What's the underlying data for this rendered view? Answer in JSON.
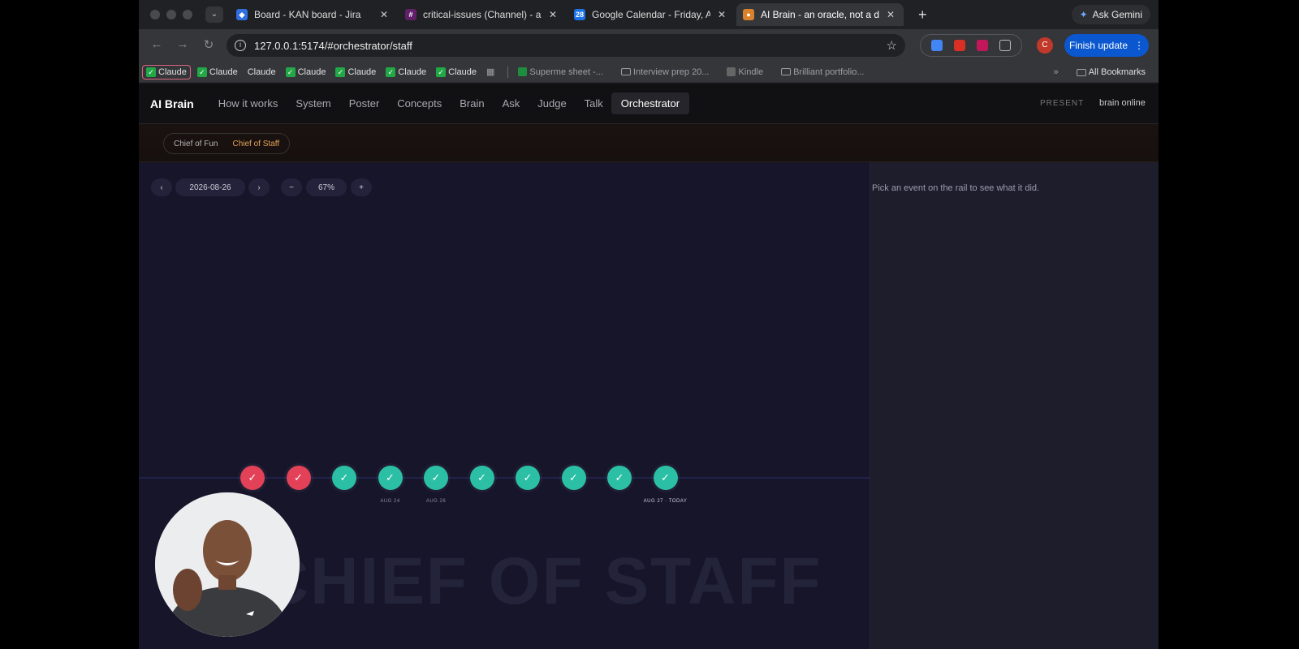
{
  "tabs": [
    {
      "title": "Board - KAN board - Jira",
      "favicon_color": "#2f6fe0",
      "favicon_glyph": "◆"
    },
    {
      "title": "critical-issues (Channel) - ai-",
      "favicon_color": "#611f69",
      "favicon_glyph": "#"
    },
    {
      "title": "Google Calendar - Friday, Au",
      "favicon_color": "#1a73e8",
      "favicon_glyph": "28"
    },
    {
      "title": "AI Brain - an oracle, not a dat",
      "favicon_color": "#d9822b",
      "favicon_glyph": "●",
      "active": true
    }
  ],
  "gemini_label": "Ask Gemini",
  "address": {
    "url": "127.0.0.1:5174/#orchestrator/staff"
  },
  "finish_update_label": "Finish update",
  "profile_initial": "C",
  "bookmarks": [
    {
      "label": "Claude",
      "check": true,
      "boxed": true
    },
    {
      "label": "Claude",
      "check": true
    },
    {
      "label": "Claude",
      "check": false
    },
    {
      "label": "Claude",
      "check": true
    },
    {
      "label": "Claude",
      "check": true
    },
    {
      "label": "Claude",
      "check": true
    },
    {
      "label": "Claude",
      "check": true
    }
  ],
  "bookmarks_more": [
    {
      "label": "Superme sheet -...",
      "icon": "sheet"
    },
    {
      "label": "Interview prep 20...",
      "icon": "folder"
    },
    {
      "label": "Kindle",
      "icon": "kindle"
    },
    {
      "label": "Brilliant portfolio...",
      "icon": "folder"
    }
  ],
  "all_bookmarks_label": "All Bookmarks",
  "app": {
    "brand": "AI Brain",
    "nav": [
      "How it works",
      "System",
      "Poster",
      "Concepts",
      "Brain",
      "Ask",
      "Judge",
      "Talk",
      "Orchestrator"
    ],
    "active_nav": "Orchestrator",
    "present_label": "PRESENT",
    "status_label": "brain online",
    "sub_tabs": [
      "Chief of Fun",
      "Chief of Staff"
    ],
    "active_sub_tab": "Chief of Staff"
  },
  "controls": {
    "prev": "‹",
    "date": "2026-08-26",
    "next": "›",
    "zoom_out": "−",
    "zoom": "67%",
    "zoom_in": "+"
  },
  "timeline": {
    "events": [
      {
        "status": "fail",
        "label": ""
      },
      {
        "status": "fail",
        "label": ""
      },
      {
        "status": "ok",
        "label": ""
      },
      {
        "status": "ok",
        "label": "AUG 24"
      },
      {
        "status": "ok",
        "label": "AUG 26"
      },
      {
        "status": "ok",
        "label": ""
      },
      {
        "status": "ok",
        "label": ""
      },
      {
        "status": "ok",
        "label": ""
      },
      {
        "status": "ok",
        "label": ""
      },
      {
        "status": "ok",
        "label": "AUG 27 · TODAY"
      }
    ],
    "watermark": "CHIEF OF STAFF"
  },
  "side_panel": {
    "message": "Pick an event on the rail to see what it did."
  }
}
